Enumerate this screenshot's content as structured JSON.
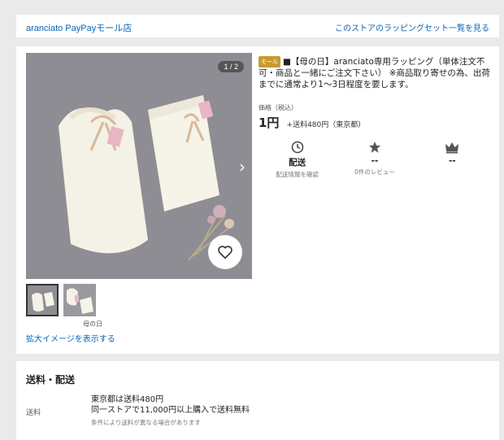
{
  "store_bar": {
    "store_name": "aranciato PayPayモール店",
    "wrapping_link": "このストアのラッピングセット一覧を見る"
  },
  "gallery": {
    "counter": "1 / 2",
    "thumbnail_caption": "母の日",
    "zoom_link": "拡大イメージを表示する"
  },
  "product": {
    "badge": "モール",
    "title": "■【母の日】aranciato専用ラッピング（単体注文不可・商品と一緒にご注文下さい） ※商品取り寄せの為、出荷までに通常より1～3日程度を要します。",
    "price_label": "価格（税込）",
    "price": "1円",
    "shipping_fee": "+送料480円（東京都）"
  },
  "stats": {
    "delivery": {
      "icon": "clock-icon",
      "value": "配送",
      "sub": "配送情報を確認"
    },
    "reviews": {
      "icon": "star-icon",
      "value": "--",
      "sub": "0件のレビュー"
    },
    "ranking": {
      "icon": "crown-icon",
      "value": "--"
    }
  },
  "shipping": {
    "heading": "送料・配送",
    "label": "送料",
    "line1": "東京都は送料480円",
    "line2": "同一ストアで11,000円以上購入で送料無料",
    "note": "条件により送料が異なる場合があります"
  },
  "colors": {
    "link": "#0a64b4",
    "badge": "#c99a2e",
    "background": "#eaeaea"
  }
}
